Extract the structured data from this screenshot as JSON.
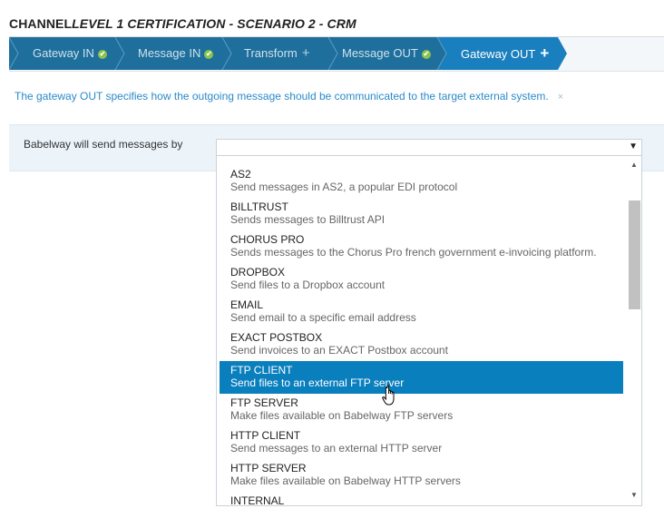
{
  "header": {
    "title_prefix": "CHANNEL",
    "title_main": "LEVEL 1 CERTIFICATION - SCENARIO 2 - CRM"
  },
  "steps": [
    {
      "label": "Gateway IN",
      "status": "done"
    },
    {
      "label": "Message IN",
      "status": "done"
    },
    {
      "label": "Transform",
      "status": "todo"
    },
    {
      "label": "Message OUT",
      "status": "done"
    },
    {
      "label": "Gateway OUT",
      "status": "active"
    }
  ],
  "colors": {
    "step_bg": "#1e6f9c",
    "step_active": "#1a7fbe",
    "selected_option": "#0a7fbd",
    "info_text": "#2a8ac9",
    "check": "#8bc34a"
  },
  "info": {
    "text": "The gateway OUT specifies how the outgoing message should be communicated to the target external system.",
    "close": "×"
  },
  "form": {
    "label": "Babelway will send messages by",
    "selected_value": ""
  },
  "options": [
    {
      "name": "AS2",
      "desc": "Send messages in AS2, a popular EDI protocol"
    },
    {
      "name": "BILLTRUST",
      "desc": "Sends messages to Billtrust API"
    },
    {
      "name": "CHORUS PRO",
      "desc": "Sends messages to the Chorus Pro french government e-invoicing platform."
    },
    {
      "name": "DROPBOX",
      "desc": "Send files to a Dropbox account"
    },
    {
      "name": "EMAIL",
      "desc": "Send email to a specific email address"
    },
    {
      "name": "EXACT POSTBOX",
      "desc": "Send invoices to an EXACT Postbox account"
    },
    {
      "name": "FTP CLIENT",
      "desc": "Send files to an external FTP server"
    },
    {
      "name": "FTP SERVER",
      "desc": "Make files available on Babelway FTP servers"
    },
    {
      "name": "HTTP CLIENT",
      "desc": "Send messages to an external HTTP server"
    },
    {
      "name": "HTTP SERVER",
      "desc": "Make files available on Babelway HTTP servers"
    },
    {
      "name": "INTERNAL",
      "desc": ""
    }
  ],
  "highlighted_option": "FTP CLIENT"
}
